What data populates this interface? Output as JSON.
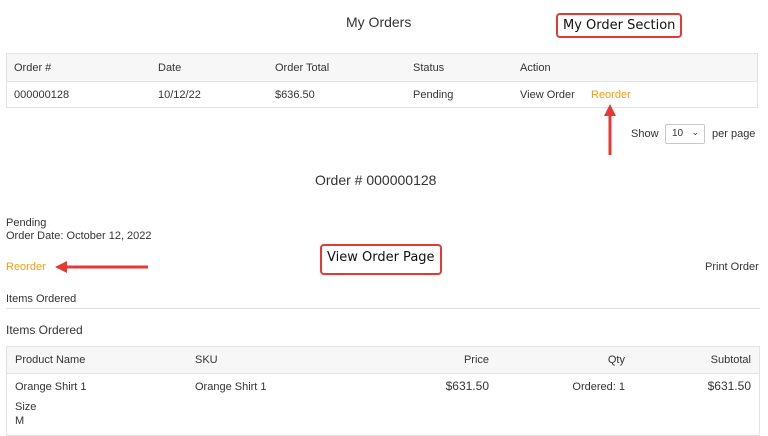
{
  "my_orders": {
    "title": "My Orders",
    "columns": [
      "Order #",
      "Date",
      "Order Total",
      "Status",
      "Action"
    ],
    "row": {
      "order_number": "000000128",
      "date": "10/12/22",
      "total": "$636.50",
      "status": "Pending",
      "view_label": "View Order",
      "reorder_label": "Reorder"
    },
    "pager": {
      "show_label": "Show",
      "per_page_value": "10",
      "per_page_label": "per page"
    }
  },
  "order_view": {
    "title": "Order # 000000128",
    "status": "Pending",
    "order_date": "Order Date: October 12, 2022",
    "reorder_label": "Reorder",
    "print_label": "Print Order",
    "items_ordered_tab": "Items Ordered",
    "items_ordered_heading": "Items Ordered",
    "columns": [
      "Product Name",
      "SKU",
      "Price",
      "Qty",
      "Subtotal"
    ],
    "item": {
      "name": "Orange Shirt 1",
      "sku": "Orange Shirt 1",
      "price": "$631.50",
      "qty": "Ordered: 1",
      "subtotal": "$631.50",
      "option_label": "Size",
      "option_value": "M"
    }
  },
  "annotations": {
    "my_order_section": "My Order Section",
    "view_order_page": "View Order Page"
  },
  "colors": {
    "accent": "#f39c12",
    "annotation": "#e53935"
  }
}
